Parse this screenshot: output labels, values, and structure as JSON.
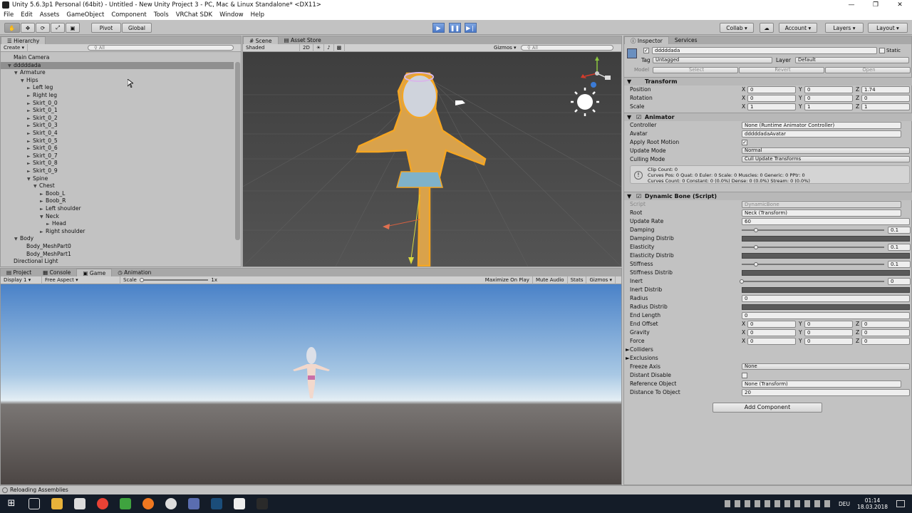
{
  "window": {
    "title": "Unity 5.6.3p1 Personal (64bit) - Untitled - New Unity Project 3 - PC, Mac & Linux Standalone* <DX11>"
  },
  "menu": [
    "File",
    "Edit",
    "Assets",
    "GameObject",
    "Component",
    "Tools",
    "VRChat SDK",
    "Window",
    "Help"
  ],
  "toolbar": {
    "pivot": "Pivot",
    "global": "Global",
    "collab": "Collab ▾",
    "account": "Account",
    "layers": "Layers",
    "layout": "Layout"
  },
  "hierarchy": {
    "tab": "Hierarchy",
    "create": "Create",
    "search": "All",
    "items": [
      {
        "label": "Main Camera",
        "depth": 0,
        "arrow": ""
      },
      {
        "label": "dddddada",
        "depth": 0,
        "arrow": "▼",
        "selected": true
      },
      {
        "label": "Armature",
        "depth": 1,
        "arrow": "▼"
      },
      {
        "label": "Hips",
        "depth": 2,
        "arrow": "▼"
      },
      {
        "label": "Left leg",
        "depth": 3,
        "arrow": "►"
      },
      {
        "label": "Right leg",
        "depth": 3,
        "arrow": "►"
      },
      {
        "label": "Skirt_0_0",
        "depth": 3,
        "arrow": "►"
      },
      {
        "label": "Skirt_0_1",
        "depth": 3,
        "arrow": "►"
      },
      {
        "label": "Skirt_0_2",
        "depth": 3,
        "arrow": "►"
      },
      {
        "label": "Skirt_0_3",
        "depth": 3,
        "arrow": "►"
      },
      {
        "label": "Skirt_0_4",
        "depth": 3,
        "arrow": "►"
      },
      {
        "label": "Skirt_0_5",
        "depth": 3,
        "arrow": "►"
      },
      {
        "label": "Skirt_0_6",
        "depth": 3,
        "arrow": "►"
      },
      {
        "label": "Skirt_0_7",
        "depth": 3,
        "arrow": "►"
      },
      {
        "label": "Skirt_0_8",
        "depth": 3,
        "arrow": "►"
      },
      {
        "label": "Skirt_0_9",
        "depth": 3,
        "arrow": "►"
      },
      {
        "label": "Spine",
        "depth": 3,
        "arrow": "▼"
      },
      {
        "label": "Chest",
        "depth": 4,
        "arrow": "▼"
      },
      {
        "label": "Boob_L",
        "depth": 5,
        "arrow": "►"
      },
      {
        "label": "Boob_R",
        "depth": 5,
        "arrow": "►"
      },
      {
        "label": "Left shoulder",
        "depth": 5,
        "arrow": "►"
      },
      {
        "label": "Neck",
        "depth": 5,
        "arrow": "▼"
      },
      {
        "label": "Head",
        "depth": 6,
        "arrow": "►"
      },
      {
        "label": "Right shoulder",
        "depth": 5,
        "arrow": "►"
      },
      {
        "label": "Body",
        "depth": 1,
        "arrow": "▼"
      },
      {
        "label": "Body_MeshPart0",
        "depth": 2,
        "arrow": ""
      },
      {
        "label": "Body_MeshPart1",
        "depth": 2,
        "arrow": ""
      },
      {
        "label": "Directional Light",
        "depth": 0,
        "arrow": ""
      }
    ]
  },
  "scene": {
    "tabs": [
      "Scene",
      "Asset Store"
    ],
    "shading": "Shaded",
    "mode2d": "2D",
    "gizmos": "Gizmos ▾",
    "search": "All"
  },
  "game": {
    "tabs": [
      "Project",
      "Console",
      "Game",
      "Animation"
    ],
    "display": "Display 1",
    "aspect": "Free Aspect",
    "scale_label": "Scale",
    "scale_value": "1x",
    "buttons": [
      "Maximize On Play",
      "Mute Audio",
      "Stats",
      "Gizmos ▾"
    ]
  },
  "inspector": {
    "tabs": [
      "Inspector",
      "Services"
    ],
    "object_name": "dddddada",
    "static": "Static",
    "tag_label": "Tag",
    "tag": "Untagged",
    "layer_label": "Layer",
    "layer": "Default",
    "model_label": "Model",
    "model_buttons": [
      "Select",
      "Revert",
      "Open"
    ],
    "transform": {
      "title": "Transform",
      "rows": [
        {
          "label": "Position",
          "x": "0",
          "y": "0",
          "z": "1.74"
        },
        {
          "label": "Rotation",
          "x": "0",
          "y": "0",
          "z": "0"
        },
        {
          "label": "Scale",
          "x": "1",
          "y": "1",
          "z": "1"
        }
      ]
    },
    "animator": {
      "title": "Animator",
      "controller_label": "Controller",
      "controller": "None (Runtime Animator Controller)",
      "avatar_label": "Avatar",
      "avatar": "dddddadaAvatar",
      "root_motion_label": "Apply Root Motion",
      "update_label": "Update Mode",
      "update": "Normal",
      "culling_label": "Culling Mode",
      "culling": "Cull Update Transforms",
      "info1": "Clip Count: 0",
      "info2": "Curves Pos: 0 Quat: 0 Euler: 0 Scale: 0 Muscles: 0 Generic: 0 PPtr: 0",
      "info3": "Curves Count: 0 Constant: 0 (0.0%) Dense: 0 (0.0%) Stream: 0 (0.0%)"
    },
    "dynbone": {
      "title": "Dynamic Bone (Script)",
      "script_label": "Script",
      "script": "DynamicBone",
      "root_label": "Root",
      "root": "Neck (Transform)",
      "rate_label": "Update Rate",
      "rate": "60",
      "damping_label": "Damping",
      "damping": "0.1",
      "damping_pos": 0.1,
      "damping_distrib": "Damping Distrib",
      "elasticity_label": "Elasticity",
      "elasticity": "0.1",
      "elasticity_pos": 0.1,
      "elasticity_distrib": "Elasticity Distrib",
      "stiffness_label": "Stiffness",
      "stiffness": "0.1",
      "stiffness_pos": 0.1,
      "stiffness_distrib": "Stiffness Distrib",
      "inert_label": "Inert",
      "inert": "0",
      "inert_pos": 0,
      "inert_distrib": "Inert Distrib",
      "radius_label": "Radius",
      "radius": "0",
      "radius_distrib": "Radius Distrib",
      "endlength_label": "End Length",
      "endlength": "0",
      "vec_rows": [
        {
          "label": "End Offset",
          "x": "0",
          "y": "0",
          "z": "0"
        },
        {
          "label": "Gravity",
          "x": "0",
          "y": "0",
          "z": "0"
        },
        {
          "label": "Force",
          "x": "0",
          "y": "0",
          "z": "0"
        }
      ],
      "colliders": "Colliders",
      "exclusions": "Exclusions",
      "freeze_label": "Freeze Axis",
      "freeze": "None",
      "distant_label": "Distant Disable",
      "ref_label": "Reference Object",
      "ref": "None (Transform)",
      "dist_label": "Distance To Object",
      "dist": "20"
    },
    "add_component": "Add Component"
  },
  "status": "Reloading Assemblies",
  "tray": {
    "lang": "DEU",
    "time": "01:14",
    "date": "18.03.2018"
  },
  "colors": {
    "unity_bg": "#c2c2c2",
    "play_blue": "#4a77c6",
    "scene_bg": "#4b4b4b",
    "taskbar": "#141c28",
    "selection_orange": "#f5a623"
  }
}
